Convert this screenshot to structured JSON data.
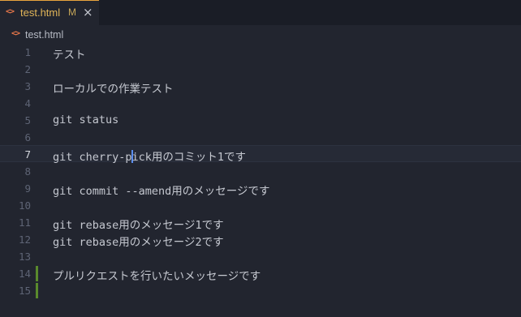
{
  "tab": {
    "icon": "<>",
    "label": "test.html",
    "badge": "M",
    "close": "×"
  },
  "breadcrumb": {
    "icon": "<>",
    "label": "test.html"
  },
  "lines": [
    {
      "num": "1",
      "text": "テスト"
    },
    {
      "num": "2",
      "text": ""
    },
    {
      "num": "3",
      "text": "ローカルでの作業テスト"
    },
    {
      "num": "4",
      "text": ""
    },
    {
      "num": "5",
      "text": "git status"
    },
    {
      "num": "6",
      "text": ""
    },
    {
      "num": "7",
      "text_before_cursor": "git cherry-p",
      "text_after_cursor": "ick用のコミット1です"
    },
    {
      "num": "8",
      "text": ""
    },
    {
      "num": "9",
      "text": "git commit --amend用のメッセージです"
    },
    {
      "num": "10",
      "text": ""
    },
    {
      "num": "11",
      "text": "git rebase用のメッセージ1です"
    },
    {
      "num": "12",
      "text": "git rebase用のメッセージ2です"
    },
    {
      "num": "13",
      "text": ""
    },
    {
      "num": "14",
      "text": "プルリクエストを行いたいメッセージです"
    },
    {
      "num": "15",
      "text": ""
    }
  ],
  "active_line": "7",
  "colors": {
    "background": "#22252f",
    "tab_label": "#e0b458",
    "gutter_added": "#5a8a2c",
    "cursor": "#5b8ef0",
    "file_icon": "#e8774a"
  },
  "icons": {
    "tab_file_icon": "html-file-icon",
    "breadcrumb_file_icon": "html-file-icon",
    "tab_close": "close-icon"
  }
}
